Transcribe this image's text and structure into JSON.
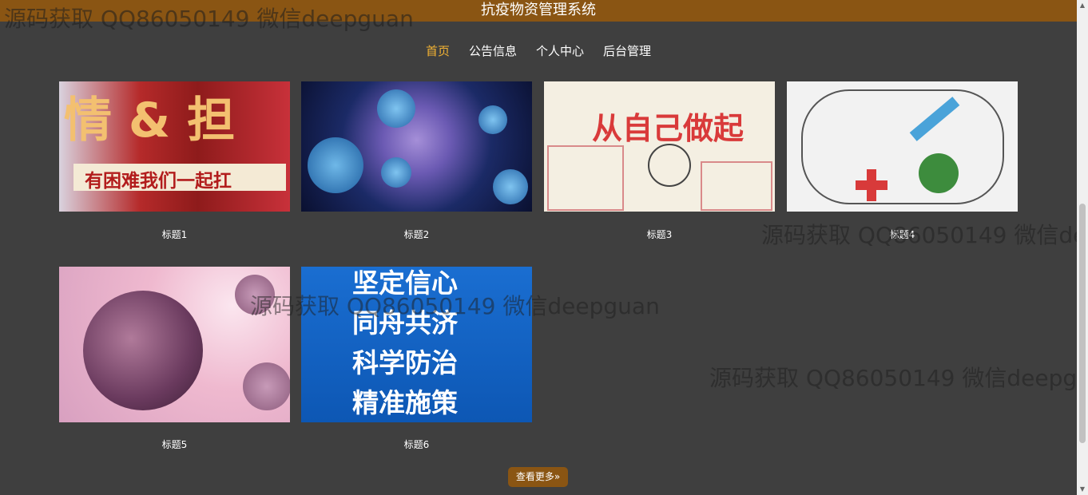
{
  "header": {
    "title": "抗疫物资管理系统"
  },
  "nav": {
    "items": [
      {
        "label": "首页",
        "active": true
      },
      {
        "label": "公告信息",
        "active": false
      },
      {
        "label": "个人中心",
        "active": false
      },
      {
        "label": "后台管理",
        "active": false
      }
    ]
  },
  "cards": [
    {
      "title": "标题1",
      "image_text": [
        "情 & 担",
        "有困难我们一起扛"
      ]
    },
    {
      "title": "标题2",
      "image_text": []
    },
    {
      "title": "标题3",
      "image_text": [
        "从自己做起"
      ]
    },
    {
      "title": "标题4",
      "image_text": []
    },
    {
      "title": "标题5",
      "image_text": []
    },
    {
      "title": "标题6",
      "image_text": [
        "坚定信心",
        "同舟共济",
        "科学防治",
        "精准施策"
      ]
    }
  ],
  "more_button": {
    "label": "查看更多»"
  },
  "watermark": "源码获取 QQ86050149 微信deepguan",
  "colors": {
    "header_bg": "#8a5513",
    "active_nav": "#f2b233",
    "page_bg": "#3f3f3f"
  }
}
